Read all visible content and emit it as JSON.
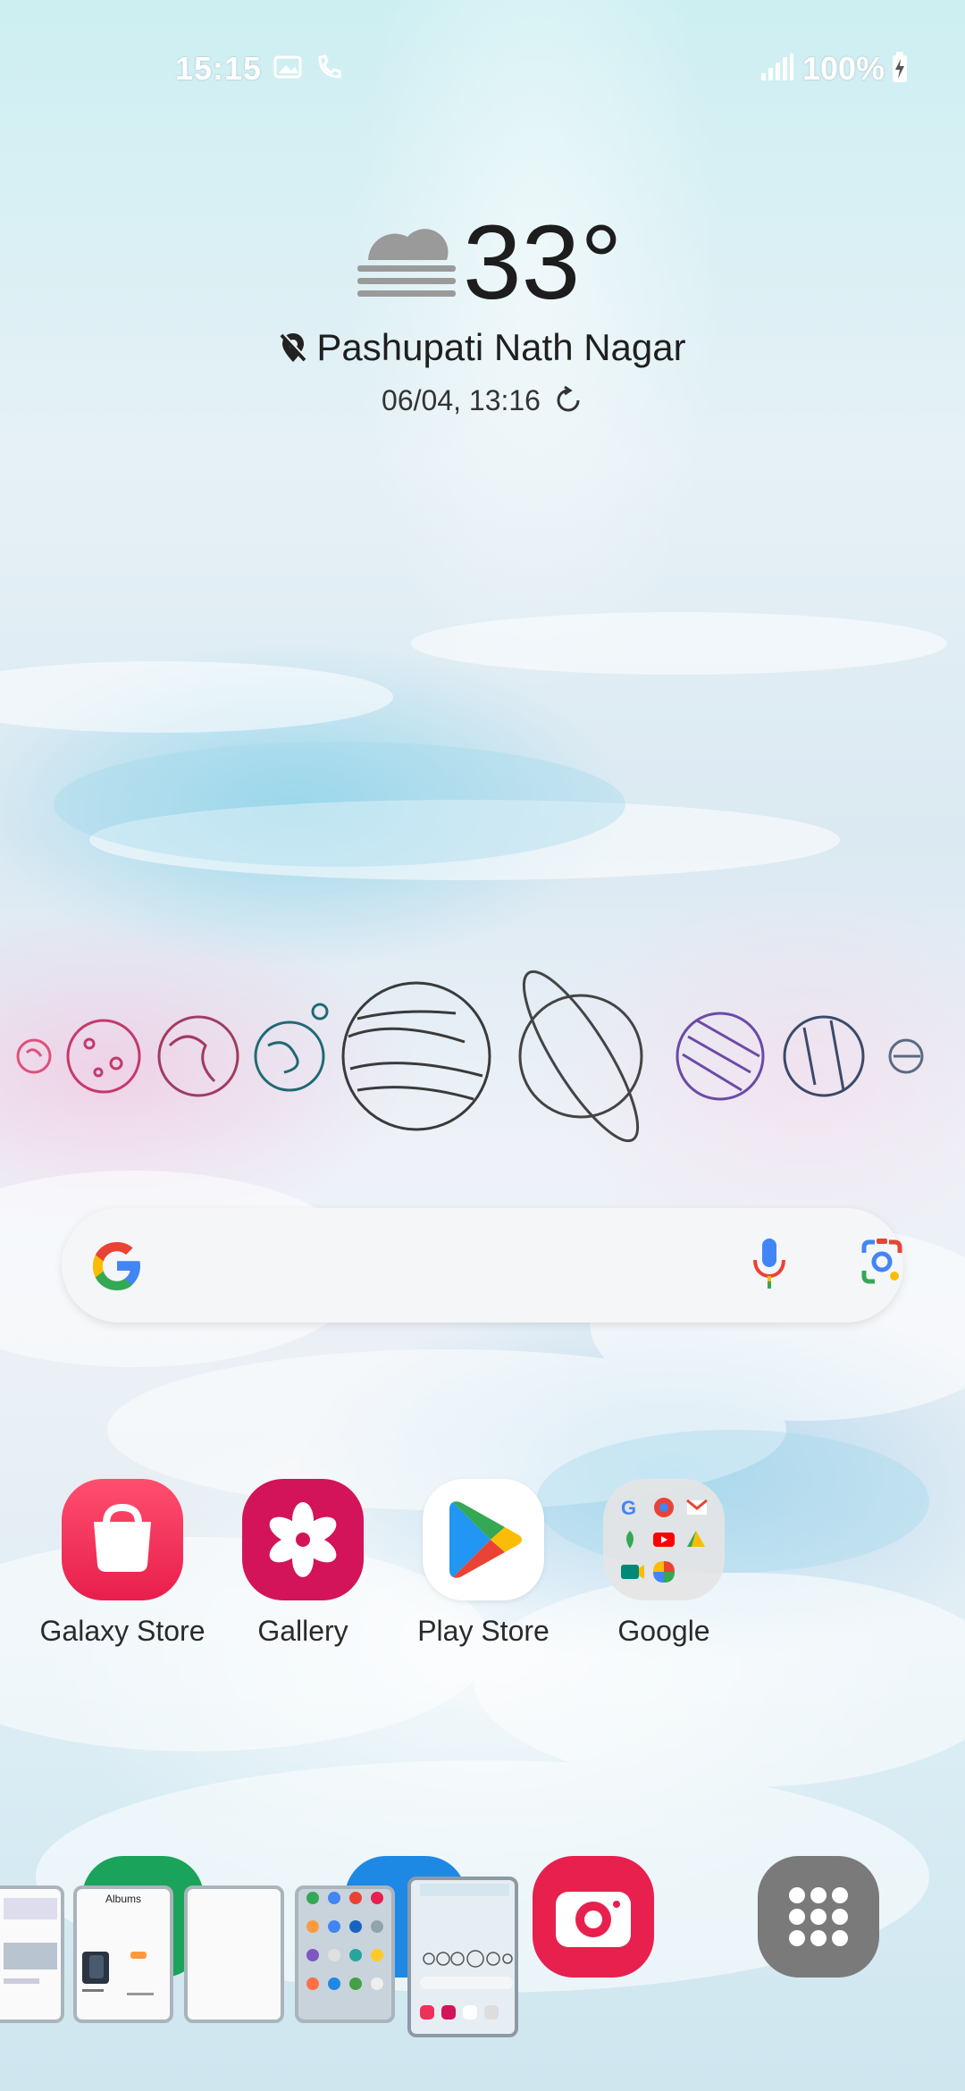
{
  "status_bar": {
    "time": "15:15",
    "battery": "100%"
  },
  "weather": {
    "temperature": "33°",
    "location": "Pashupati Nath Nagar",
    "updated": "06/04, 13:16"
  },
  "search": {
    "placeholder": ""
  },
  "apps": [
    {
      "label": "Galaxy Store",
      "icon": "galaxy-store-bag-icon",
      "color": "#f0305a"
    },
    {
      "label": "Gallery",
      "icon": "gallery-flower-icon",
      "color": "#d3135a"
    },
    {
      "label": "Play Store",
      "icon": "play-store-icon",
      "color": "#ffffff"
    },
    {
      "label": "Google",
      "icon": "google-folder-icon",
      "color": "#e4e4e4"
    }
  ],
  "dock": {
    "recent_albums_label": "Albums",
    "camera_color": "#e8204e",
    "apps_drawer_color": "#7a7a7a"
  }
}
